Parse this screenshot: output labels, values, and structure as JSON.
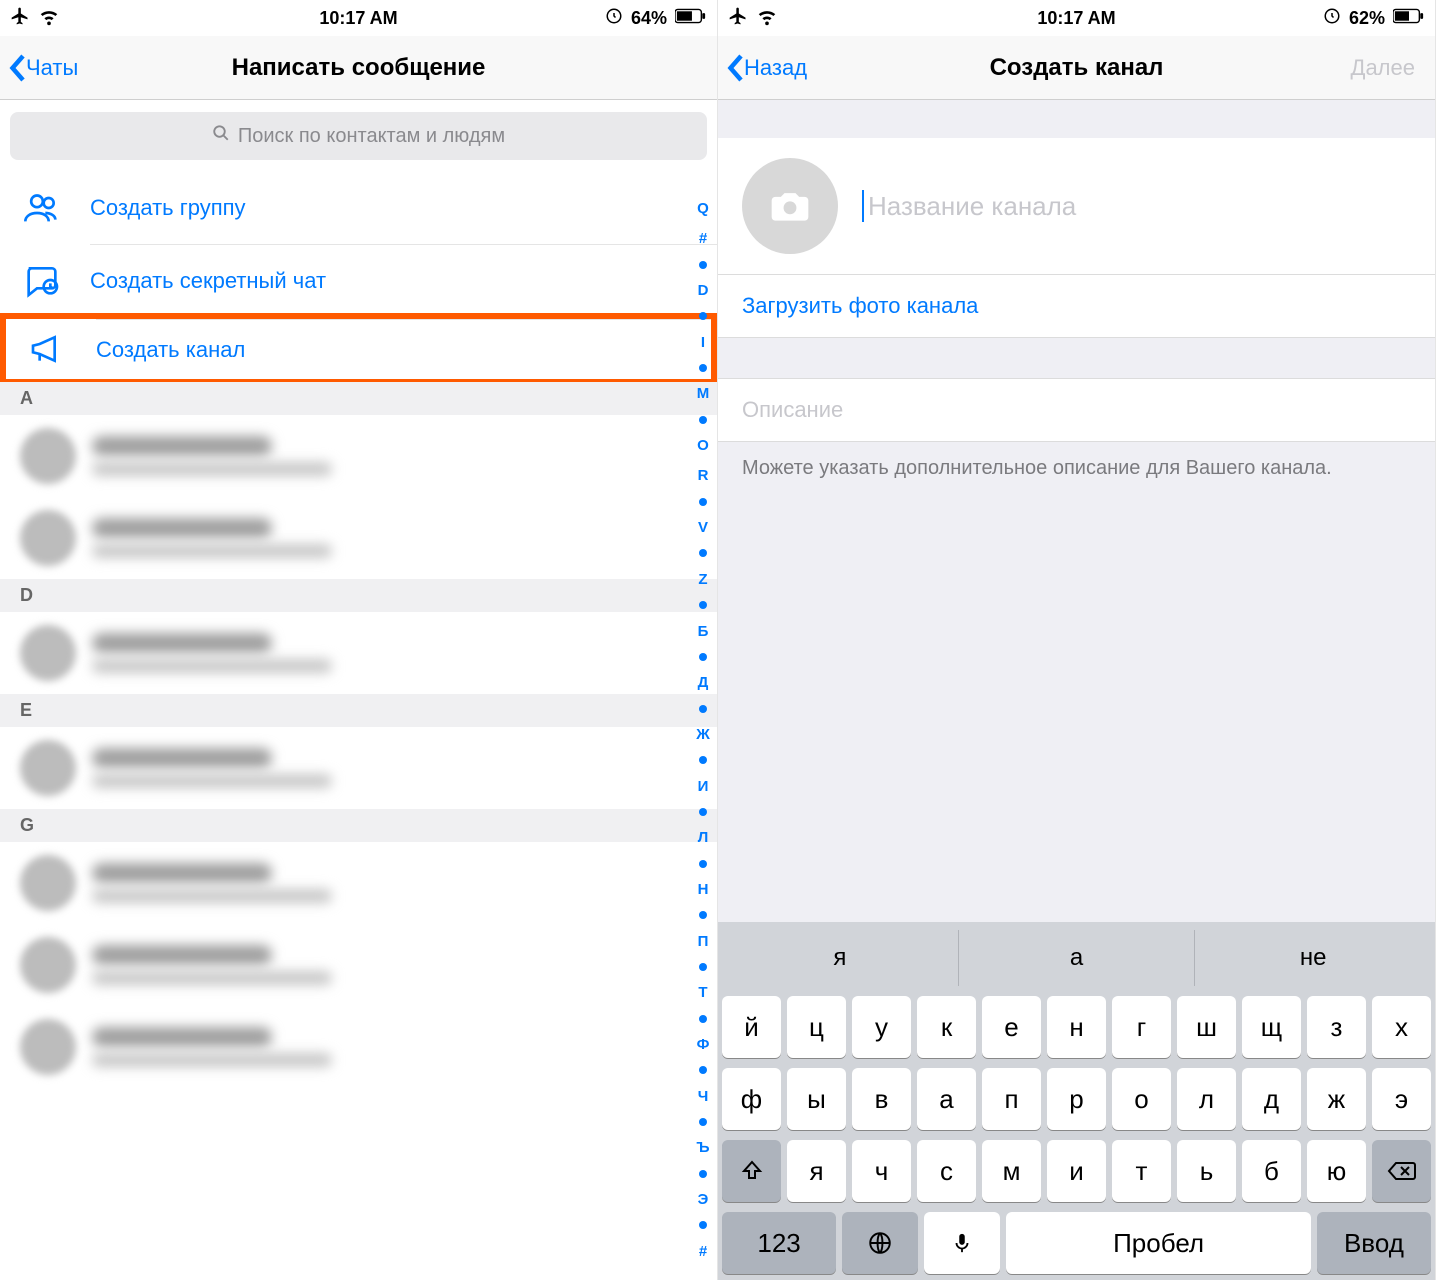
{
  "left": {
    "status": {
      "time": "10:17 AM",
      "battery": "64%"
    },
    "nav": {
      "back": "Чаты",
      "title": "Написать сообщение"
    },
    "search_placeholder": "Поиск по контактам и людям",
    "actions": {
      "group": "Создать группу",
      "secret": "Создать секретный чат",
      "channel": "Создать канал"
    },
    "sections": [
      "A",
      "D",
      "E",
      "G"
    ],
    "index": [
      "Q",
      "#",
      "●",
      "D",
      "●",
      "I",
      "●",
      "M",
      "●",
      "O",
      "R",
      "●",
      "V",
      "●",
      "Z",
      "●",
      "Б",
      "●",
      "Д",
      "●",
      "Ж",
      "●",
      "И",
      "●",
      "Л",
      "●",
      "Н",
      "●",
      "П",
      "●",
      "Т",
      "●",
      "Ф",
      "●",
      "Ч",
      "●",
      "Ъ",
      "●",
      "Э",
      "●",
      "#"
    ]
  },
  "right": {
    "status": {
      "time": "10:17 AM",
      "battery": "62%"
    },
    "nav": {
      "back": "Назад",
      "title": "Создать канал",
      "next": "Далее"
    },
    "name_placeholder": "Название канала",
    "upload": "Загрузить фото канала",
    "desc_placeholder": "Описание",
    "desc_hint": "Можете указать дополнительное описание для Вашего канала.",
    "keyboard": {
      "predictions": [
        "я",
        "а",
        "не"
      ],
      "row1": [
        "й",
        "ц",
        "у",
        "к",
        "е",
        "н",
        "г",
        "ш",
        "щ",
        "з",
        "х"
      ],
      "row2": [
        "ф",
        "ы",
        "в",
        "а",
        "п",
        "р",
        "о",
        "л",
        "д",
        "ж",
        "э"
      ],
      "row3": [
        "я",
        "ч",
        "с",
        "м",
        "и",
        "т",
        "ь",
        "б",
        "ю"
      ],
      "bottom": {
        "num": "123",
        "space": "Пробел",
        "enter": "Ввод"
      }
    }
  }
}
